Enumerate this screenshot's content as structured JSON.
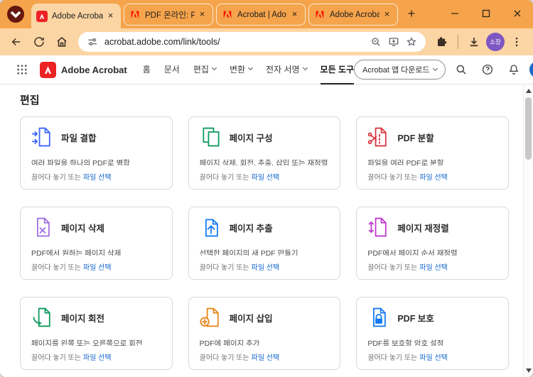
{
  "browser": {
    "tabs": [
      {
        "title": "Adobe Acrobat"
      },
      {
        "title": "PDF 온라인: PD"
      },
      {
        "title": "Acrobat | Ado"
      },
      {
        "title": "Adobe Acroba"
      }
    ],
    "address": {
      "url": "acrobat.adobe.com/link/tools/"
    },
    "profile_badge": "소장"
  },
  "acrobat_header": {
    "brand": "Adobe Acrobat",
    "nav": [
      {
        "label": "홈"
      },
      {
        "label": "문서"
      },
      {
        "label": "편집"
      },
      {
        "label": "변환"
      },
      {
        "label": "전자 서명"
      },
      {
        "label": "모든 도구"
      }
    ],
    "download_app_button": "Acrobat 앱 다운로드"
  },
  "page": {
    "section_title": "편집",
    "drop_hint": "끌어다 놓기 또는",
    "file_select_link": "파일 선택",
    "cards": [
      {
        "title": "파일 결합",
        "description": "여러 파일을 하나의 PDF로 병합",
        "icon": "combine-files-icon",
        "accent": "#3B63FB"
      },
      {
        "title": "페이지 구성",
        "description": "페이지 삭제, 회전, 추출, 삽입 또는 재정렬",
        "icon": "organize-pages-icon",
        "accent": "#0C9A5E"
      },
      {
        "title": "PDF 분할",
        "description": "파일을 여러 PDF로 분할",
        "icon": "split-pdf-icon",
        "accent": "#D7373F"
      },
      {
        "title": "페이지 삭제",
        "description": "PDF에서 원하는 페이지 삭제",
        "icon": "delete-pages-icon",
        "accent": "#9F6FE0"
      },
      {
        "title": "페이지 추출",
        "description": "선택한 페이지의 새 PDF 만들기",
        "icon": "extract-pages-icon",
        "accent": "#147AF3"
      },
      {
        "title": "페이지 재정렬",
        "description": "PDF에서 페이지 순서 재정렬",
        "icon": "reorder-pages-icon",
        "accent": "#C038CC"
      },
      {
        "title": "페이지 회전",
        "description": "페이지를 왼쪽 또는 오른쪽으로 회전",
        "icon": "rotate-pages-icon",
        "accent": "#0C9A5E"
      },
      {
        "title": "페이지 삽입",
        "description": "PDF에 페이지 추가",
        "icon": "insert-pages-icon",
        "accent": "#E68619"
      },
      {
        "title": "PDF 보호",
        "description": "PDF를 보호할 암호 설정",
        "icon": "protect-pdf-icon",
        "accent": "#147AF3"
      }
    ]
  },
  "colors": {
    "theme_frame": "#F5A44C",
    "theme_toolbar": "#FCD5A4",
    "link_blue": "#1066CE",
    "acrobat_red": "#ED2224"
  }
}
